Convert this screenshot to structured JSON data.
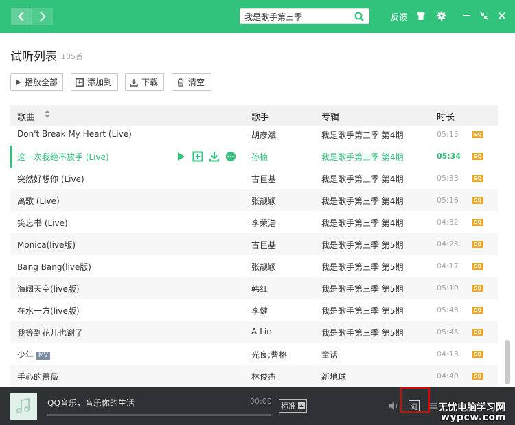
{
  "search": {
    "value": "我是歌手第三季"
  },
  "topbar": {
    "feedback_label": "反馈"
  },
  "list": {
    "title": "试听列表",
    "count": "105首"
  },
  "toolbar": {
    "play_all": "播放全部",
    "add_to": "添加到",
    "download": "下载",
    "clear": "清空"
  },
  "table": {
    "headers": {
      "song": "歌曲",
      "artist": "歌手",
      "album": "专辑",
      "duration": "时长"
    },
    "quality_badge": "SQ",
    "rows": [
      {
        "song": "Don't Break My Heart (Live)",
        "artist": "胡彦斌",
        "album": "我是歌手第三季 第4期",
        "duration": "05:15"
      },
      {
        "song": "这一次我绝不放手 (Live)",
        "artist": "孙楠",
        "album": "我是歌手第三季 第4期",
        "duration": "05:34"
      },
      {
        "song": "突然好想你 (Live)",
        "artist": "古巨基",
        "album": "我是歌手第三季 第4期",
        "duration": "05:33"
      },
      {
        "song": "离歌 (Live)",
        "artist": "张靓颖",
        "album": "我是歌手第三季 第4期",
        "duration": "05:18"
      },
      {
        "song": "笑忘书 (Live)",
        "artist": "李荣浩",
        "album": "我是歌手第三季 第4期",
        "duration": "04:32"
      },
      {
        "song": "Monica(live版)",
        "artist": "古巨基",
        "album": "我是歌手第三季 第5期",
        "duration": "04:23"
      },
      {
        "song": "Bang Bang(live版)",
        "artist": "张靓颖",
        "album": "我是歌手第三季 第5期",
        "duration": "04:17"
      },
      {
        "song": "海阔天空(live版)",
        "artist": "韩红",
        "album": "我是歌手第三季 第5期",
        "duration": "05:10"
      },
      {
        "song": "在水一方(live版)",
        "artist": "李健",
        "album": "我是歌手第三季 第5期",
        "duration": "05:43"
      },
      {
        "song": "我等到花儿也谢了",
        "artist": "A-Lin",
        "album": "我是歌手第三季 第5期",
        "duration": "05:45"
      },
      {
        "song": "少年",
        "artist": "光良;曹格",
        "album": "童话",
        "duration": "04:13"
      },
      {
        "song": "手心的蔷薇",
        "artist": "林俊杰",
        "album": "新地球",
        "duration": "04:40"
      }
    ],
    "mv_badge": "MV"
  },
  "player": {
    "title": "QQ音乐，音乐你的生活",
    "time": "00:00",
    "quality": "标准",
    "lyric_label": "词"
  },
  "watermark": {
    "line1": "无忧电脑学习网",
    "line2": "wypcw.com"
  },
  "colors": {
    "accent": "#31c27c",
    "sq_badge": "#f5a623",
    "player_bg": "#2e3235",
    "highlight_box": "#e00000"
  }
}
